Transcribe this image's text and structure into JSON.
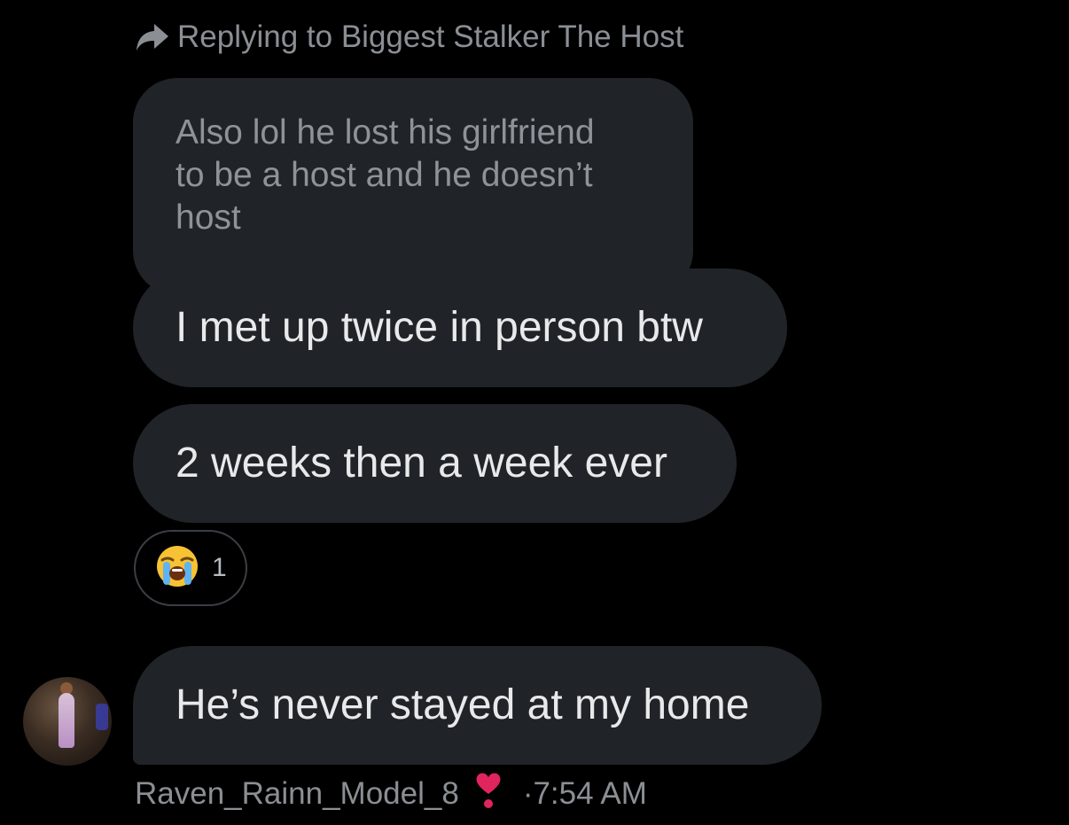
{
  "reply_header": {
    "icon": "reply-arrow-icon",
    "text": "Replying to Biggest Stalker The Host"
  },
  "quoted_message": {
    "text": "Also lol he lost his girlfriend\nto be a host and he doesn’t\nhost"
  },
  "messages": [
    {
      "text": "I met up twice in person btw"
    },
    {
      "text": "2 weeks then a week ever"
    },
    {
      "text": "He’s never stayed at my home"
    }
  ],
  "reaction": {
    "emoji": "😭",
    "count": "1"
  },
  "footer": {
    "username": "Raven_Rainn_Model_8",
    "heart_icon": "heart-exclamation-icon",
    "separator": "·",
    "time": "7:54 AM"
  },
  "colors": {
    "background": "#000000",
    "bubble": "#202327",
    "primary_text": "#e7e9ea",
    "secondary_text": "#8b8f94",
    "heart": "#e0245e"
  }
}
